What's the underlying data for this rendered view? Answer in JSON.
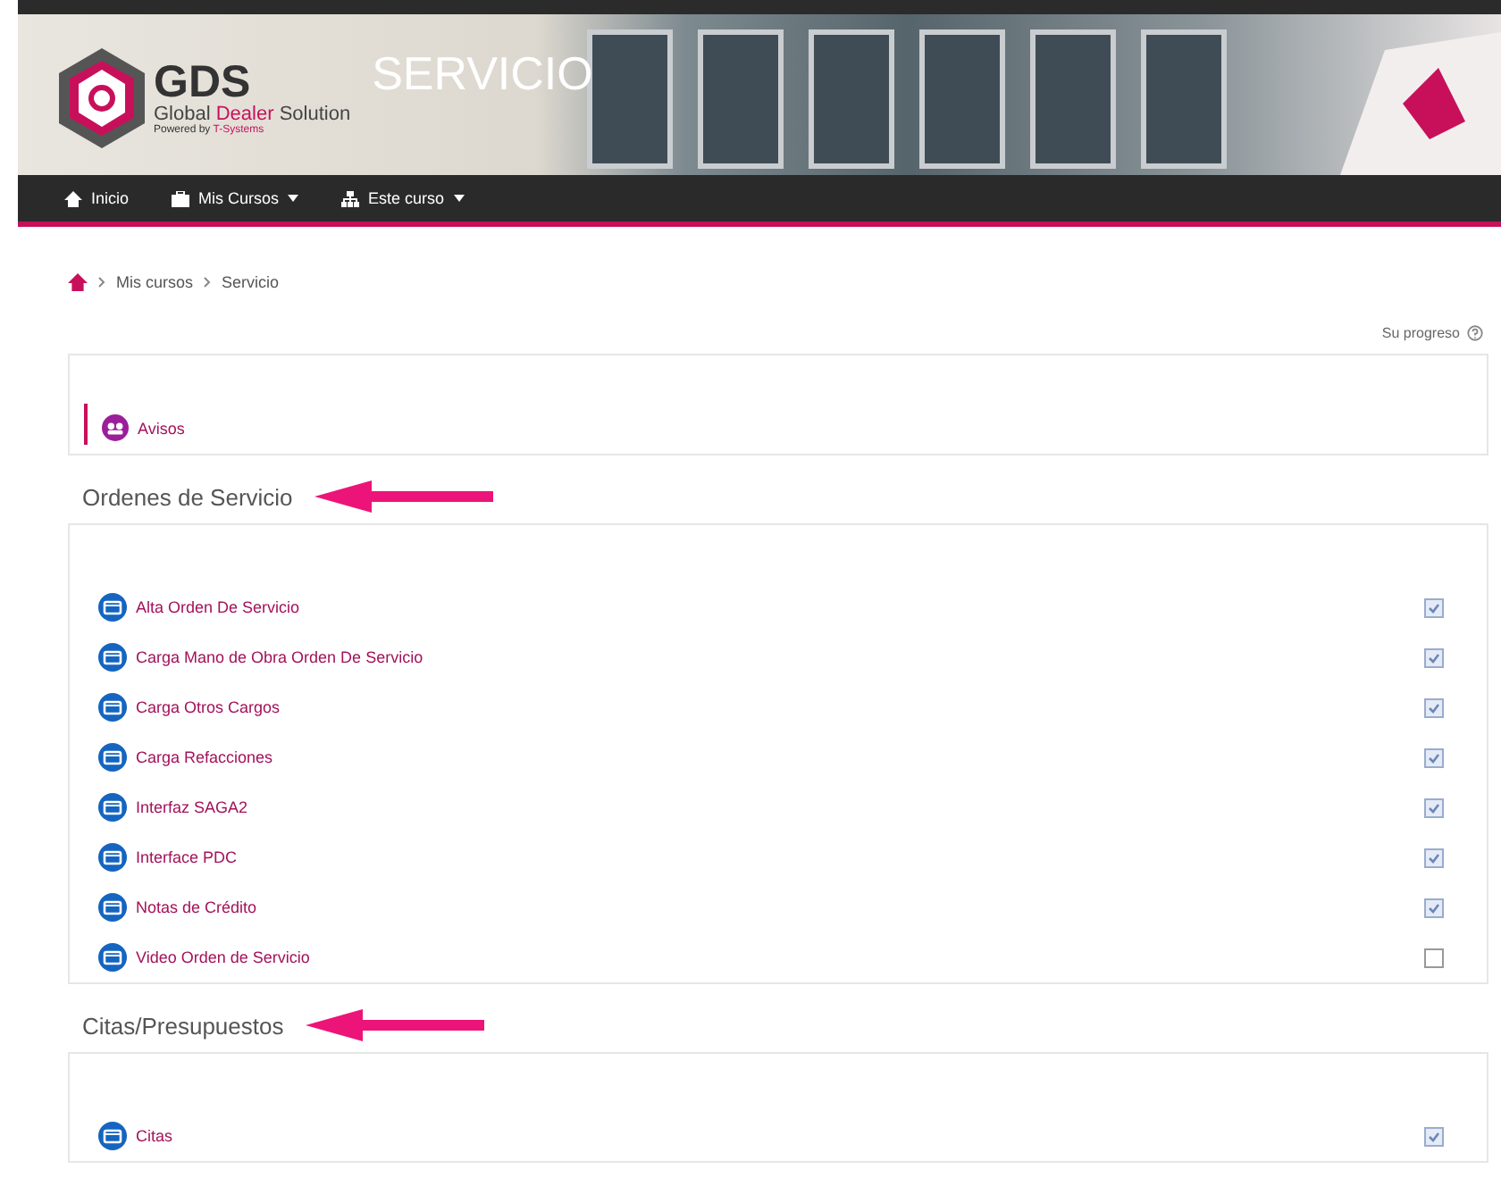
{
  "header": {
    "logo_title": "GDS",
    "logo_subtitle_parts": [
      "Global ",
      "Dealer",
      " Solution"
    ],
    "logo_powered": [
      "Powered by ",
      "T-Systems"
    ],
    "course_title": "SERVICIO"
  },
  "nav": [
    {
      "label": "Inicio",
      "dropdown": false
    },
    {
      "label": "Mis Cursos",
      "dropdown": true
    },
    {
      "label": "Este curso",
      "dropdown": true
    }
  ],
  "breadcrumb": [
    "Mis cursos",
    "Servicio"
  ],
  "progress_label": "Su progreso",
  "intro": {
    "items": [
      {
        "label": "Avisos"
      }
    ]
  },
  "sections": [
    {
      "title": "Ordenes de Servicio",
      "arrow": true,
      "items": [
        {
          "label": "Alta Orden De Servicio",
          "checked": true
        },
        {
          "label": "Carga Mano de Obra Orden De Servicio",
          "checked": true
        },
        {
          "label": "Carga Otros Cargos",
          "checked": true
        },
        {
          "label": "Carga Refacciones",
          "checked": true
        },
        {
          "label": "Interfaz SAGA2",
          "checked": true
        },
        {
          "label": "Interface PDC",
          "checked": true
        },
        {
          "label": "Notas de Crédito",
          "checked": true
        },
        {
          "label": "Video Orden de Servicio",
          "checked": false
        }
      ]
    },
    {
      "title": "Citas/Presupuestos",
      "arrow": true,
      "items": [
        {
          "label": "Citas",
          "checked": true
        }
      ]
    }
  ]
}
